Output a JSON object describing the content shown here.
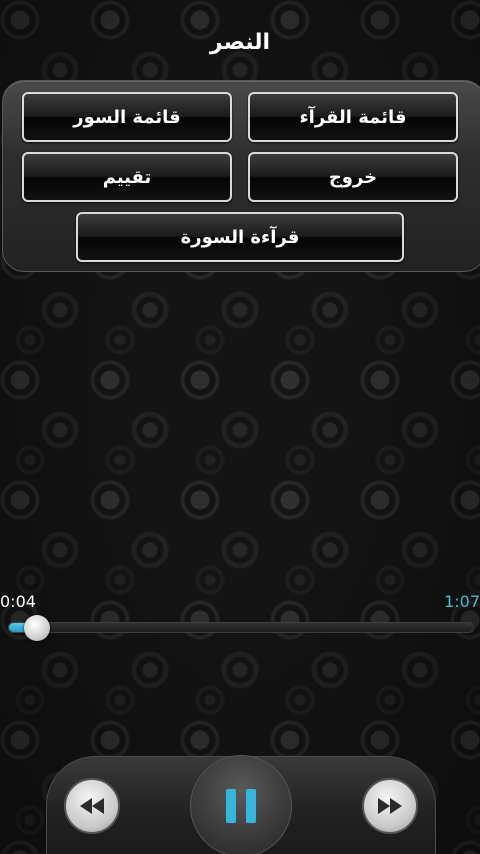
{
  "header": {
    "title": "النصر"
  },
  "menu": {
    "reciters_label": "قائمة القرآء",
    "surahs_label": "قائمة السور",
    "exit_label": "خروج",
    "rate_label": "تقييم",
    "read_label": "قرآءة السورة"
  },
  "player": {
    "current_time": "0:04",
    "total_time": "1:07",
    "progress_percent": 6
  },
  "controls": {
    "rewind_icon": "rewind-icon",
    "pause_icon": "pause-icon",
    "forward_icon": "fast-forward-icon"
  },
  "colors": {
    "accent": "#4fb6d6",
    "background": "#141414",
    "button_border": "#d9d9d9"
  }
}
